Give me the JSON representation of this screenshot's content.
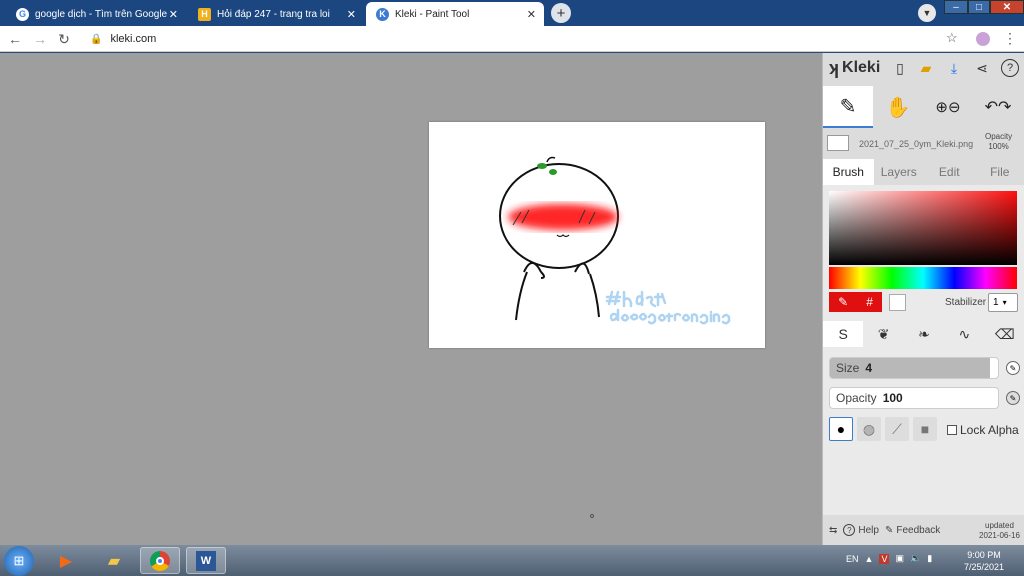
{
  "browser": {
    "tabs": [
      {
        "title": "google dịch - Tìm trên Google",
        "favicon": "G"
      },
      {
        "title": "Hỏi đáp 247 - trang tra loi",
        "favicon": "H"
      },
      {
        "title": "Kleki - Paint Tool",
        "favicon": "K"
      }
    ],
    "url": "kleki.com"
  },
  "panel": {
    "logo": "Kleki",
    "file_name": "2021_07_25_0ym_Kleki.png",
    "opacity_label": "Opacity",
    "opacity_value": "100%",
    "tabs": [
      "Brush",
      "Layers",
      "Edit",
      "File"
    ],
    "stabilizer_label": "Stabilizer",
    "stabilizer_value": "1",
    "hex_symbol": "#",
    "size_label": "Size",
    "size_value": "4",
    "size_level": 0.95,
    "opacity_slider_label": "Opacity",
    "opacity_slider_value": "100",
    "lock_alpha": "Lock Alpha",
    "help": "Help",
    "feedback": "Feedback",
    "updated_label": "updated",
    "updated_date": "2021-06-16",
    "primary_color": "#e01010"
  },
  "taskbar": {
    "lang": "EN",
    "time": "9:00 PM",
    "date": "7/25/2021"
  }
}
